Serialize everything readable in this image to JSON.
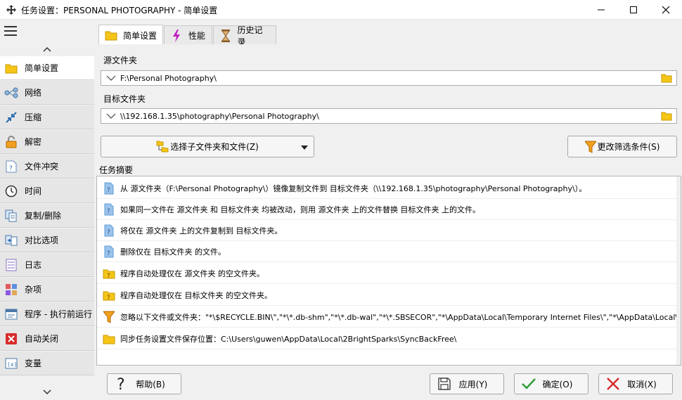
{
  "window": {
    "title": "任务设置：PERSONAL PHOTOGRAPHY - 简单设置"
  },
  "sidebar": {
    "items": [
      {
        "label": "简单设置",
        "icon": "folder-icon"
      },
      {
        "label": "网络",
        "icon": "network-icon"
      },
      {
        "label": "压缩",
        "icon": "compress-icon"
      },
      {
        "label": "解密",
        "icon": "lock-icon"
      },
      {
        "label": "文件冲突",
        "icon": "file-question-icon"
      },
      {
        "label": "时间",
        "icon": "clock-icon"
      },
      {
        "label": "复制/删除",
        "icon": "copy-delete-icon"
      },
      {
        "label": "对比选项",
        "icon": "compare-icon"
      },
      {
        "label": "日志",
        "icon": "log-icon"
      },
      {
        "label": "杂项",
        "icon": "misc-icon"
      },
      {
        "label": "程序 - 执行前运行",
        "icon": "program-icon"
      },
      {
        "label": "自动关闭",
        "icon": "auto-close-icon"
      },
      {
        "label": "变量",
        "icon": "variable-icon"
      }
    ]
  },
  "tabs": [
    {
      "label": "简单设置",
      "icon": "folder-icon"
    },
    {
      "label": "性能",
      "icon": "lightning-icon"
    },
    {
      "label": "历史记录",
      "icon": "hourglass-icon"
    }
  ],
  "source": {
    "label": "源文件夹",
    "value": "F:\\Personal Photography\\"
  },
  "destination": {
    "label": "目标文件夹",
    "value": "\\\\192.168.1.35\\photography\\Personal Photography\\"
  },
  "buttons": {
    "select_subfolders": "选择子文件夹和文件(Z)",
    "change_filter": "更改筛选条件(S)"
  },
  "summary": {
    "label": "任务摘要",
    "rows": [
      {
        "icon": "doc-question-icon",
        "text": "从 源文件夹（F:\\Personal Photography\\）镜像复制文件到 目标文件夹（\\\\192.168.1.35\\photography\\Personal Photography\\）。"
      },
      {
        "icon": "doc-question-icon",
        "text": "如果同一文件在 源文件夹 和 目标文件夹 均被改动，则用 源文件夹 上的文件替换 目标文件夹 上的文件。"
      },
      {
        "icon": "doc-question-icon",
        "text": "将仅在 源文件夹 上的文件复制到 目标文件夹。"
      },
      {
        "icon": "doc-question-icon",
        "text": "删除仅在 目标文件夹 的文件。"
      },
      {
        "icon": "folder-question-icon",
        "text": "程序自动处理仅在 源文件夹 的空文件夹。"
      },
      {
        "icon": "folder-question-icon",
        "text": "程序自动处理仅在 目标文件夹 的空文件夹。"
      },
      {
        "icon": "filter-icon",
        "text": "忽略以下文件或文件夹：\"*\\$RECYCLE.BIN\\\",\"*\\*.db-shm\",\"*\\*.db-wal\",\"*\\*.SBSECOR\",\"*\\AppData\\Local\\Temporary Internet Files\\\",\"*\\AppData\\Local\\Temp\\\",\"*\\Application Da..."
      },
      {
        "icon": "folder-icon",
        "text": "同步任务设置文件保存位置：C:\\Users\\guwen\\AppData\\Local\\2BrightSparks\\SyncBackFree\\"
      }
    ]
  },
  "footer": {
    "help": "帮助(B)",
    "apply": "应用(Y)",
    "ok": "确定(O)",
    "cancel": "取消(X)"
  },
  "colors": {
    "folder_yellow": "#f5c518",
    "doc_blue": "#5b9bd5",
    "ok_green": "#2e9e3a",
    "cancel_red": "#d62c2c"
  }
}
